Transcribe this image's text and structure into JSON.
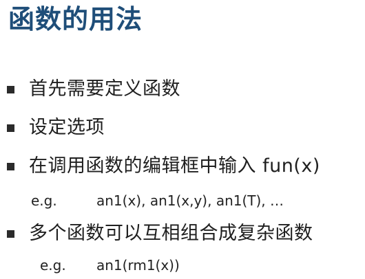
{
  "title": "函数的用法",
  "bullets": [
    {
      "text": "首先需要定义函数"
    },
    {
      "text": "设定选项"
    },
    {
      "text": "在调用函数的编辑框中输入 fun(x)"
    },
    {
      "text": "多个函数可以互相组合成复杂函数"
    }
  ],
  "examples": [
    {
      "label": "e.g.",
      "value": "an1(x), an1(x,y), an1(T), …"
    },
    {
      "label": "e.g.",
      "value": "an1(rm1(x))"
    }
  ],
  "colors": {
    "title": "#1f4e79",
    "text": "#1f1f1f",
    "bullet_marker": "#2b2b2b"
  }
}
